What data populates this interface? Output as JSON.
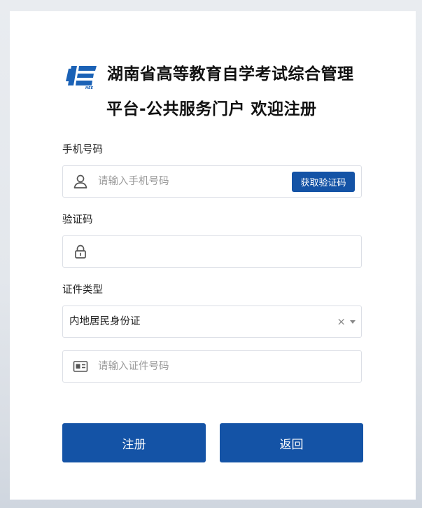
{
  "header": {
    "title_line1": "湖南省高等教育自学考试综合管理",
    "title_line2": "平台-公共服务门户 欢迎注册"
  },
  "form": {
    "phone": {
      "label": "手机号码",
      "placeholder": "请输入手机号码",
      "icon": "user-icon",
      "get_code_label": "获取验证码"
    },
    "code": {
      "label": "验证码",
      "placeholder": "",
      "icon": "lock-icon"
    },
    "id_type": {
      "label": "证件类型",
      "selected": "内地居民身份证",
      "clear": "×"
    },
    "id_number": {
      "placeholder": "请输入证件号码",
      "icon": "id-card-icon"
    }
  },
  "actions": {
    "register_label": "注册",
    "back_label": "返回"
  },
  "colors": {
    "primary": "#1453a6",
    "border": "#dcdfe6"
  }
}
